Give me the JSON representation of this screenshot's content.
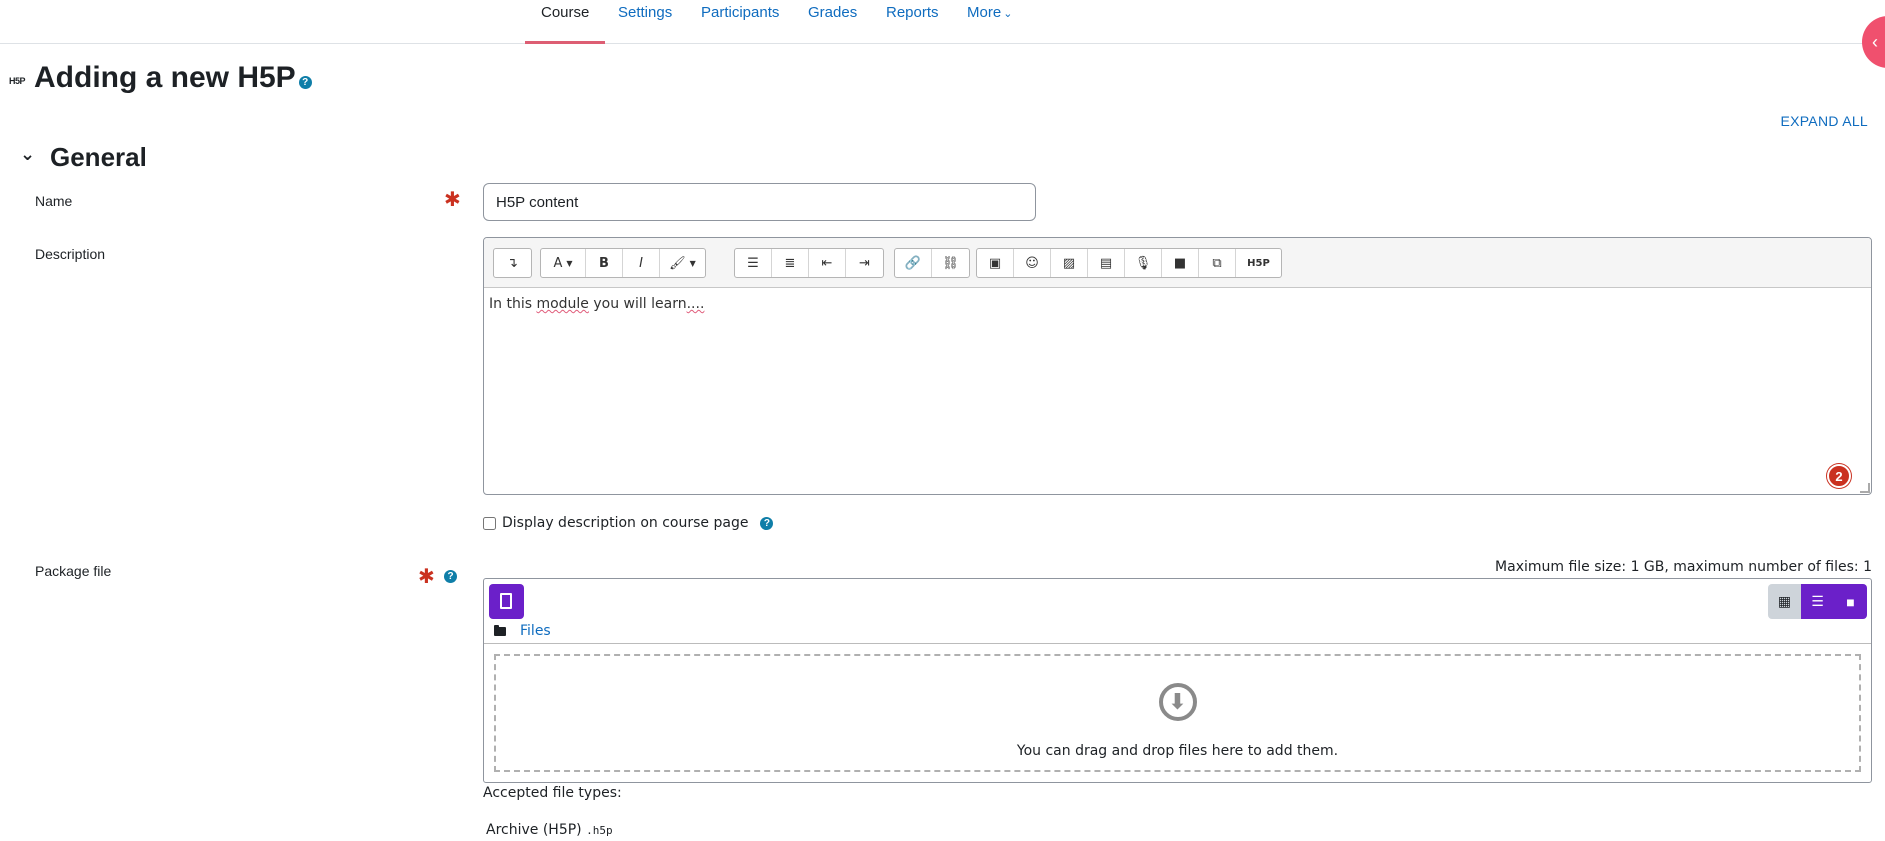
{
  "nav": {
    "tabs": [
      {
        "label": "Course",
        "active": true
      },
      {
        "label": "Settings"
      },
      {
        "label": "Participants"
      },
      {
        "label": "Grades"
      },
      {
        "label": "Reports"
      },
      {
        "label": "More"
      }
    ]
  },
  "header": {
    "logo_text": "H5P",
    "title": "Adding a new H5P",
    "help_glyph": "?"
  },
  "expand_all": "EXPAND ALL",
  "section": {
    "title": "General"
  },
  "fields": {
    "name": {
      "label": "Name",
      "value": "H5P content"
    },
    "description": {
      "label": "Description",
      "content": {
        "word1": "In this",
        "word2": "module",
        "word3": "you will",
        "word4": "learn",
        "word5": "...."
      },
      "badge": "2",
      "toolbar": {
        "font_label": "A",
        "bold_label": "B",
        "italic_label": "I",
        "h5p_label": "H5P"
      }
    },
    "display_description": {
      "label": "Display description on course page"
    },
    "package_file": {
      "label": "Package file",
      "max_info": "Maximum file size: 1 GB, maximum number of files: 1",
      "path_label": "Files",
      "drop_text": "You can drag and drop files here to add them.",
      "accepted_label": "Accepted file types:",
      "accepted_type_name": "Archive (H5P)",
      "accepted_type_ext": ".h5p"
    }
  },
  "required_glyph": "✱",
  "colors": {
    "accent": "#0f6cbf",
    "active_tab_underline": "#dd5e73",
    "required": "#ca3120",
    "filepicker_button": "#6b20c9",
    "drawer_toggle": "#f0506e"
  }
}
